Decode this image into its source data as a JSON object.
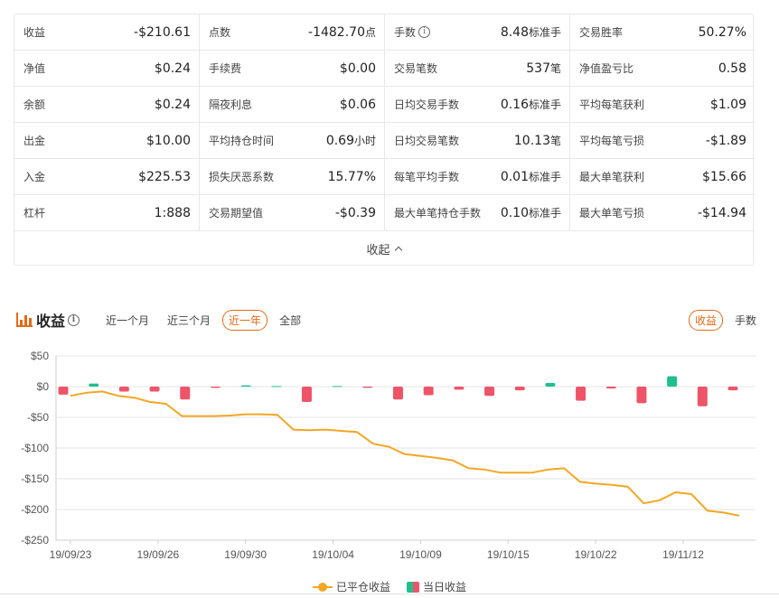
{
  "stats": [
    {
      "label": "收益",
      "value": "-$210.61",
      "unit": ""
    },
    {
      "label": "点数",
      "value": "-1482.70",
      "unit": "点"
    },
    {
      "label": "手数",
      "value": "8.48",
      "unit": "标准手",
      "info": true
    },
    {
      "label": "交易胜率",
      "value": "50.27%",
      "unit": ""
    },
    {
      "label": "净值",
      "value": "$0.24",
      "unit": ""
    },
    {
      "label": "手续费",
      "value": "$0.00",
      "unit": ""
    },
    {
      "label": "交易笔数",
      "value": "537",
      "unit": "笔"
    },
    {
      "label": "净值盈亏比",
      "value": "0.58",
      "unit": ""
    },
    {
      "label": "余额",
      "value": "$0.24",
      "unit": ""
    },
    {
      "label": "隔夜利息",
      "value": "$0.06",
      "unit": ""
    },
    {
      "label": "日均交易手数",
      "value": "0.16",
      "unit": "标准手"
    },
    {
      "label": "平均每笔获利",
      "value": "$1.09",
      "unit": ""
    },
    {
      "label": "出金",
      "value": "$10.00",
      "unit": ""
    },
    {
      "label": "平均持仓时间",
      "value": "0.69",
      "unit": "小时"
    },
    {
      "label": "日均交易笔数",
      "value": "10.13",
      "unit": "笔"
    },
    {
      "label": "平均每笔亏损",
      "value": "-$1.89",
      "unit": ""
    },
    {
      "label": "入金",
      "value": "$225.53",
      "unit": ""
    },
    {
      "label": "损失厌恶系数",
      "value": "15.77%",
      "unit": ""
    },
    {
      "label": "每笔平均手数",
      "value": "0.01",
      "unit": "标准手"
    },
    {
      "label": "最大单笔获利",
      "value": "$15.66",
      "unit": ""
    },
    {
      "label": "杠杆",
      "value": "1:888",
      "unit": ""
    },
    {
      "label": "交易期望值",
      "value": "-$0.39",
      "unit": ""
    },
    {
      "label": "最大单笔持仓手数",
      "value": "0.10",
      "unit": "标准手"
    },
    {
      "label": "最大单笔亏损",
      "value": "-$14.94",
      "unit": ""
    }
  ],
  "collapse_label": "收起",
  "chart_header": {
    "title": "收益",
    "icons": {
      "title": "bar-chart-icon",
      "info": "info-icon"
    },
    "range_tabs": [
      "近一个月",
      "近三个月",
      "近一年",
      "全部"
    ],
    "active_range": "近一年",
    "metric_tabs": [
      "收益",
      "手数"
    ],
    "active_metric": "收益"
  },
  "colors": {
    "accent": "#e46a16",
    "line": "#f5a623",
    "positive": "#1fbf8f",
    "negative": "#ee5468"
  },
  "chart_data": {
    "type": "bar",
    "y_ticks": [
      "$50",
      "$0",
      "-$50",
      "-$100",
      "-$150",
      "-$200",
      "-$250"
    ],
    "ylim": [
      -250,
      50
    ],
    "x_tick_labels": [
      "19/09/23",
      "19/09/26",
      "19/09/30",
      "19/10/04",
      "19/10/09",
      "19/10/15",
      "19/10/22",
      "19/11/12"
    ],
    "legend": [
      "已平仓收益",
      "当日收益"
    ],
    "grid": true,
    "series": [
      {
        "name": "当日收益",
        "type": "bar",
        "values": [
          -13,
          5,
          -8,
          -8,
          -21,
          -2,
          2,
          1,
          -25,
          1,
          -2,
          -21,
          -14,
          -5,
          -15,
          -6,
          6,
          -23,
          -3,
          -27,
          17,
          -32,
          -6
        ]
      },
      {
        "name": "已平仓收益",
        "type": "line",
        "values": [
          -15,
          -10,
          -8,
          -15,
          -18,
          -25,
          -28,
          -48,
          -48,
          -48,
          -47,
          -45,
          -45,
          -46,
          -70,
          -71,
          -70,
          -72,
          -74,
          -93,
          -98,
          -110,
          -113,
          -116,
          -120,
          -133,
          -135,
          -140,
          -140,
          -140,
          -135,
          -133,
          -155,
          -158,
          -160,
          -163,
          -190,
          -185,
          -172,
          -175,
          -202,
          -205,
          -210
        ]
      }
    ]
  }
}
